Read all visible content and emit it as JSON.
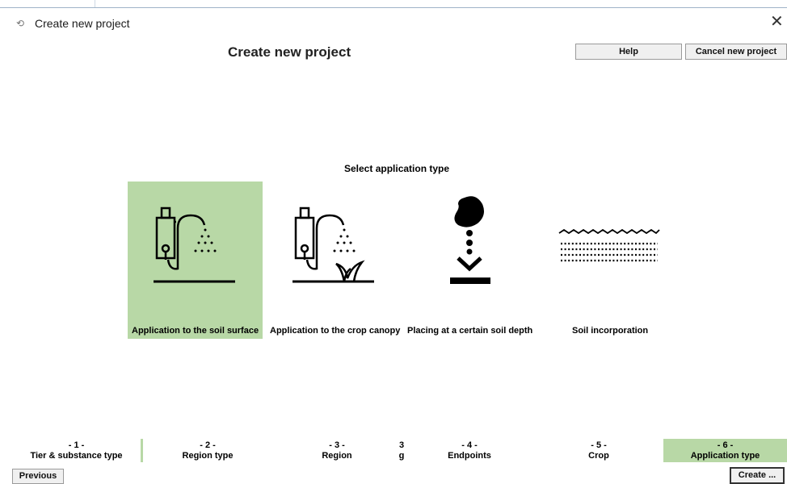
{
  "window": {
    "title": "Create new project",
    "icon": "app-icon",
    "icon_glyph": "⟲"
  },
  "header": {
    "title": "Create new project",
    "help_label": "Help",
    "cancel_label": "Cancel new project"
  },
  "main": {
    "prompt": "Select application type",
    "options": [
      {
        "label": "Application to the soil surface",
        "icon": "sprayer-soil-icon",
        "selected": true
      },
      {
        "label": "Application to the crop canopy",
        "icon": "sprayer-crop-icon",
        "selected": false
      },
      {
        "label": "Placing at a certain soil depth",
        "icon": "seed-depth-icon",
        "selected": false
      },
      {
        "label": "Soil incorporation",
        "icon": "soil-incorporation-icon",
        "selected": false
      }
    ]
  },
  "steps": [
    {
      "num": "- 1 -",
      "label": "Tier & substance type"
    },
    {
      "num": "- 2 -",
      "label": "Region type"
    },
    {
      "num": "- 3 -",
      "label": "Region"
    },
    {
      "num": "3",
      "label": "g"
    },
    {
      "num": "- 4 -",
      "label": "Endpoints"
    },
    {
      "num": "- 5 -",
      "label": "Crop"
    },
    {
      "num": "- 6 -",
      "label": "Application type",
      "active": true
    }
  ],
  "footer": {
    "previous_label": "Previous",
    "create_label": "Create ..."
  },
  "colors": {
    "selected_bg": "#b8d8a6",
    "button_bg": "#f0f0f0"
  }
}
